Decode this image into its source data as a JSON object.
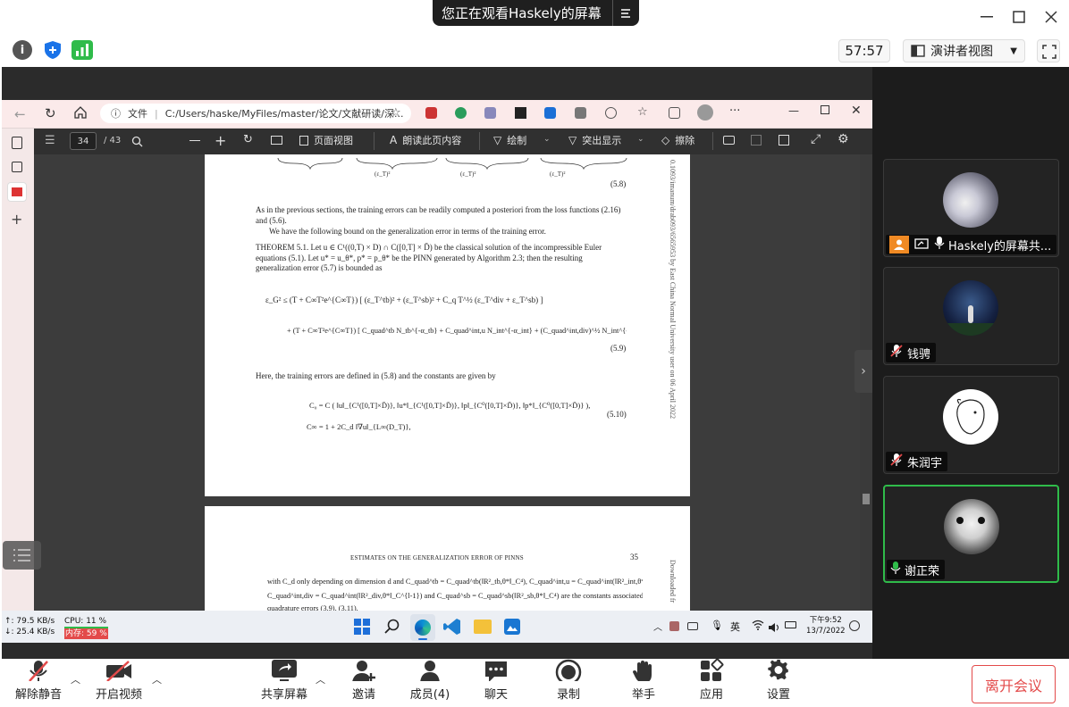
{
  "window": {
    "share_banner": "您正在观看Haskely的屏幕"
  },
  "toolbar": {
    "timer": "57:57",
    "view_label": "演讲者视图"
  },
  "browser": {
    "info_label": "文件",
    "url": "C:/Users/haske/MyFiles/master/论文/文献研读/深..."
  },
  "pdf_toolbar": {
    "page_current": "34",
    "page_total": "/ 43",
    "page_view": "页面视图",
    "read_aloud": "朗读此页内容",
    "draw": "绘制",
    "highlight": "突出显示",
    "erase": "擦除"
  },
  "pdf_page1": {
    "eq_top_num": "(5.8)",
    "para1": "As in the previous sections, the training errors can be readily computed a posteriori from the loss functions (2.16) and (5.6).",
    "para2": "We have the following bound on the generalization error in terms of the training error.",
    "theorem": "THEOREM 5.1. Let u ∈ C¹((0,T) × D) ∩ C([0,T] × D̄) be the classical solution of the incompressible Euler equations (5.1). Let u* = u_θ*, p* = p_θ* be the PINN generated by Algorithm 2.3; then the resulting generalization error (5.7) is bounded as",
    "eq59_line1": "ε_G² ≤ (T + C∞T²e^{C∞T}) [ (ε_T^tb)² + (ε_T^sb)² + C_q T^½ (ε_T^div + ε_T^sb) ]",
    "eq59_line2": "+ (T + C∞T²e^{C∞T}) [ C_quad^tb N_tb^{-α_tb} + C_quad^int,u N_int^{-α_int} + (C_quad^int,div)^½ N_int^{-α_int/2} + (C_quad^sb)^½ N_sb^{-α_sb/2} ].",
    "eq59_num": "(5.9)",
    "para3": "Here, the training errors are defined in (5.8) and the constants are given by",
    "eq510_line1": "C₀ = C ( ‖u‖_{C¹([0,T]×D̄)}, ‖u*‖_{C¹([0,T]×D̄)}, ‖p‖_{C⁰([0,T]×D̄)}, ‖p*‖_{C⁰([0,T]×D̄)} ),",
    "eq510_line2": "C∞ = 1 + 2C_d ‖∇u‖_{L∞(D_T)},",
    "eq510_num": "(5.10)",
    "margin": "0.1093/imanum/drab093/6565953 by East China Normal University user on 06 April 2022"
  },
  "pdf_page2": {
    "header": "ESTIMATES ON THE GENERALIZATION ERROR OF PINNS",
    "page_no": "35",
    "line1": "with C_d only depending on dimension d and C_quad^tb = C_quad^tb(‖R²_tb,θ*‖_C⁴), C_quad^int,u = C_quad^int(‖R²_int,θ*‖_C⁴),",
    "line2": "C_quad^int,div = C_quad^int(‖R²_div,θ*‖_C^{l-1}) and C_quad^sb = C_quad^sb(‖R²_sb,θ*‖_C⁴) are the constants associated with the",
    "line3": "quadrature errors (3.9), (3.11).",
    "margin": "Downloaded fr"
  },
  "taskbar": {
    "net_up": "↑: 79.5 KB/s",
    "net_down": "↓: 25.4 KB/s",
    "cpu": "CPU: 11 %",
    "mem": "内存: 59 %",
    "ime": "英",
    "time": "下午9:52",
    "date": "13/7/2022"
  },
  "participants": [
    {
      "name": "Haskely的屏幕共..."
    },
    {
      "name": "钱骋"
    },
    {
      "name": "朱润宇"
    },
    {
      "name": "谢正荣"
    }
  ],
  "bottom_bar": {
    "mute": "解除静音",
    "video": "开启视频",
    "share": "共享屏幕",
    "invite": "邀请",
    "members": "成员(4)",
    "chat": "聊天",
    "record": "录制",
    "raise_hand": "举手",
    "apps": "应用",
    "settings": "设置",
    "leave": "离开会议"
  },
  "colors": {
    "accent_green": "#2fbb4a",
    "leave_red": "#e34a4a",
    "shield_blue": "#1a73e8"
  }
}
